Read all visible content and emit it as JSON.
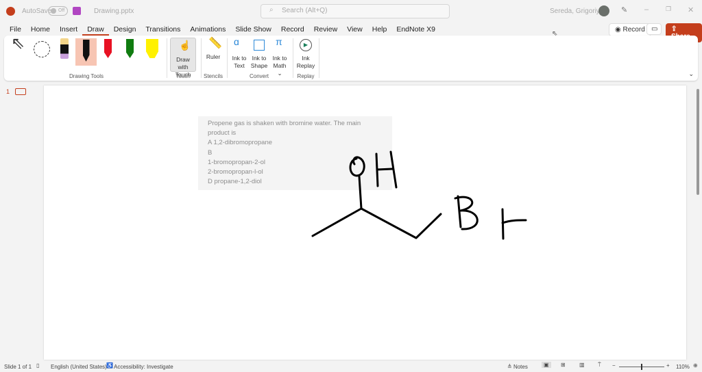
{
  "titlebar": {
    "autosave": "AutoSave",
    "toggle": "Off",
    "filename": "Drawing.pptx",
    "search_placeholder": "Search (Alt+Q)",
    "user": "Sereda, Grigoriy A"
  },
  "tabs": [
    "File",
    "Home",
    "Insert",
    "Draw",
    "Design",
    "Transitions",
    "Animations",
    "Slide Show",
    "Record",
    "Review",
    "View",
    "Help",
    "EndNote X9"
  ],
  "active_tab": "Draw",
  "actions": {
    "record": "Record",
    "share": "Share"
  },
  "ribbon": {
    "groups": {
      "drawing_tools": "Drawing Tools",
      "touch": "Touch",
      "stencils": "Stencils",
      "convert": "Convert",
      "replay": "Replay"
    },
    "draw_with_touch": "Draw with Touch",
    "ruler": "Ruler",
    "ink_to_text": "Ink to Text",
    "ink_to_shape": "Ink to Shape",
    "ink_to_math": "Ink to Math",
    "ink_replay": "Ink Replay",
    "pens": [
      {
        "color": "#000000"
      },
      {
        "color": "#e81123"
      },
      {
        "color": "#107c10"
      },
      {
        "color": "#fff100"
      }
    ]
  },
  "thumbnail": {
    "number": "1"
  },
  "slide": {
    "question_lines": [
      "Propene gas is shaken with bromine water. The main product is",
      "A 1,2-dibromopropane",
      "B",
      "1-bromopropan-2-ol",
      "2-bromopropan-l-ol",
      "D propane-1,2-diol"
    ]
  },
  "status": {
    "slide": "Slide 1 of 1",
    "language": "English (United States)",
    "accessibility": "Accessibility: Investigate",
    "notes": "Notes",
    "zoom": "110%"
  },
  "colors": {
    "accent": "#c43e1c"
  }
}
